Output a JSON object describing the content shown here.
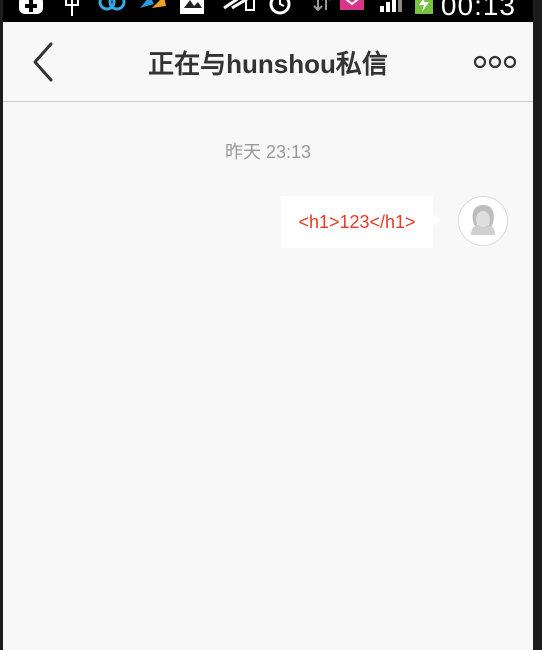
{
  "status_bar": {
    "time": "00:13",
    "icons": [
      "plus-notification-icon",
      "usb-icon",
      "sync-icon",
      "app-icon",
      "photo-icon",
      "signal-off-icon",
      "alarm-icon",
      "transfer-icon",
      "mail-icon",
      "cell-signal-icon",
      "battery-charging-icon"
    ]
  },
  "header": {
    "title": "正在与hunshou私信",
    "back_icon": "chevron-left-icon",
    "more_icon": "more-dots-icon"
  },
  "conversation": {
    "timestamp": "昨天 23:13",
    "messages": [
      {
        "text": "<h1>123</h1>",
        "sender": "self",
        "text_color": "#e53a2a"
      }
    ]
  },
  "colors": {
    "background": "#f8f8f8",
    "title": "#333333",
    "timestamp": "#999999",
    "message_text": "#e53a2a",
    "battery": "#7cc242"
  }
}
